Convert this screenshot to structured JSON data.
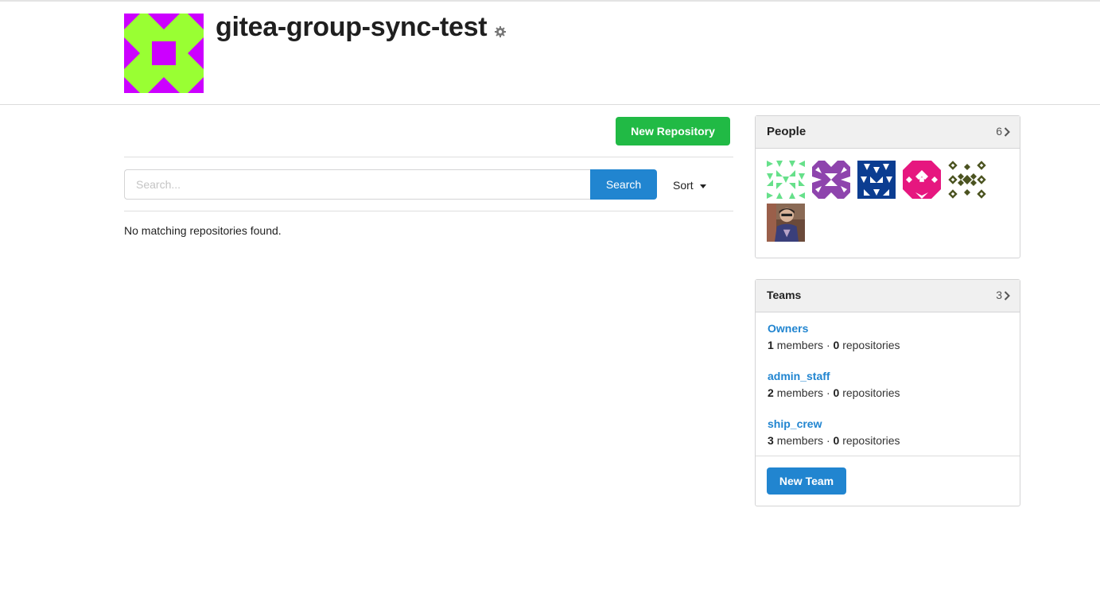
{
  "org": {
    "name": "gitea-group-sync-test",
    "avatar_colors": {
      "primary": "#cc00ff",
      "secondary": "#99ff33"
    }
  },
  "repos": {
    "new_button": "New Repository",
    "search_placeholder": "Search...",
    "search_button": "Search",
    "sort_label": "Sort",
    "empty_message": "No matching repositories found."
  },
  "people": {
    "title": "People",
    "count": "6",
    "avatars": [
      {
        "name": "identicon-mint",
        "color": "#66e08a"
      },
      {
        "name": "identicon-purple",
        "color": "#8e44ad"
      },
      {
        "name": "identicon-navy",
        "color": "#0b3d91"
      },
      {
        "name": "identicon-pink",
        "color": "#e6177f"
      },
      {
        "name": "identicon-olive",
        "color": "#4b5320"
      },
      {
        "name": "photo-avatar",
        "color": "#6b4a3a"
      }
    ]
  },
  "teams": {
    "title": "Teams",
    "count": "3",
    "sep": "·",
    "members_word": "members",
    "repos_word": "repositories",
    "items": [
      {
        "name": "Owners",
        "members": "1",
        "repos": "0"
      },
      {
        "name": "admin_staff",
        "members": "2",
        "repos": "0"
      },
      {
        "name": "ship_crew",
        "members": "3",
        "repos": "0"
      }
    ],
    "new_button": "New Team"
  },
  "colors": {
    "green": "#21ba45",
    "blue": "#2185d0"
  }
}
